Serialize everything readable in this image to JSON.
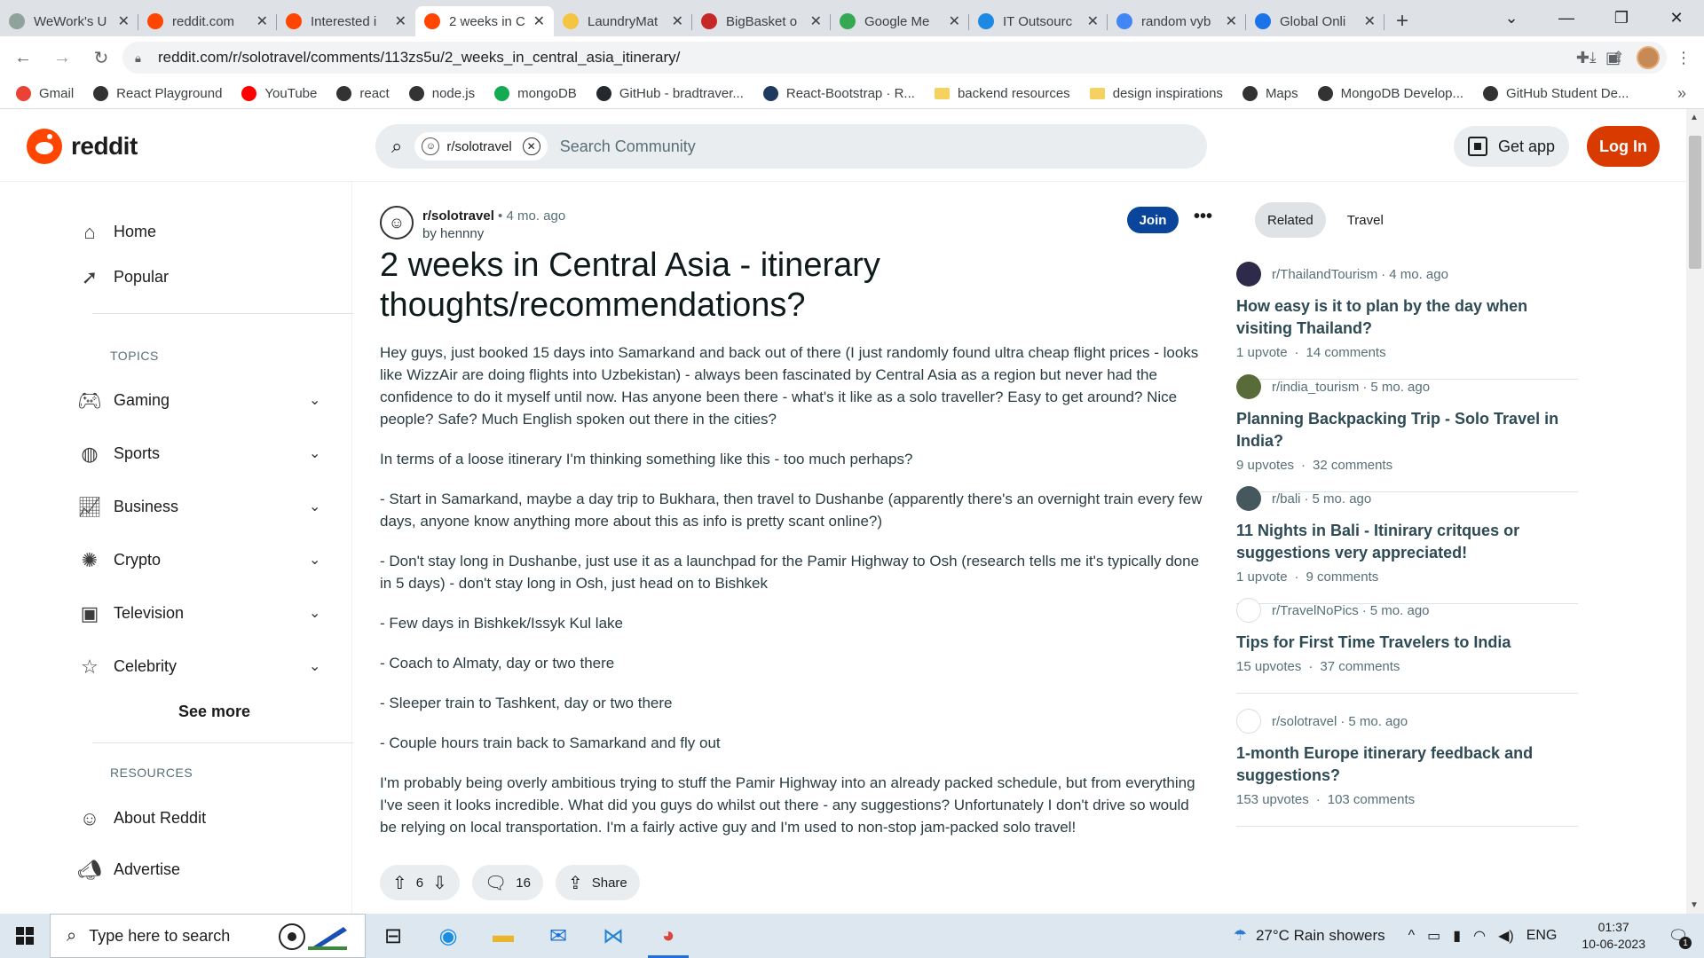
{
  "browser": {
    "tabs": [
      {
        "title": "WeWork's U",
        "icon_color": "#8fa39c",
        "active": false
      },
      {
        "title": "reddit.com",
        "icon_color": "#ff4500",
        "active": false
      },
      {
        "title": "Interested i",
        "icon_color": "#ff4500",
        "active": false
      },
      {
        "title": "2 weeks in C",
        "icon_color": "#ff4500",
        "active": true
      },
      {
        "title": "LaundryMat",
        "icon_color": "#f4c542",
        "active": false
      },
      {
        "title": "BigBasket o",
        "icon_color": "#c62828",
        "active": false
      },
      {
        "title": "Google Me",
        "icon_color": "#34a853",
        "active": false
      },
      {
        "title": "IT Outsourc",
        "icon_color": "#1e88e5",
        "active": false
      },
      {
        "title": "random vyb",
        "icon_color": "#4285f4",
        "active": false
      },
      {
        "title": "Global Onli",
        "icon_color": "#1a73e8",
        "active": false
      }
    ],
    "tab_close": "✕",
    "new_tab": "+",
    "url": "reddit.com/r/solotravel/comments/113zs5u/2_weeks_in_central_asia_itinerary/",
    "bookmarks": [
      {
        "label": "Gmail",
        "color": "#ea4335",
        "type": "icon"
      },
      {
        "label": "React Playground",
        "color": "#333333",
        "type": "icon"
      },
      {
        "label": "YouTube",
        "color": "#ff0000",
        "type": "icon"
      },
      {
        "label": "react",
        "color": "#333333",
        "type": "icon"
      },
      {
        "label": "node.js",
        "color": "#333333",
        "type": "icon"
      },
      {
        "label": "mongoDB",
        "color": "#13aa52",
        "type": "icon"
      },
      {
        "label": "GitHub - bradtraver...",
        "color": "#24292e",
        "type": "icon"
      },
      {
        "label": "React-Bootstrap · R...",
        "color": "#1f3a5f",
        "type": "icon"
      },
      {
        "label": "backend resources",
        "color": "#f5d160",
        "type": "folder"
      },
      {
        "label": "design inspirations",
        "color": "#f5d160",
        "type": "folder"
      },
      {
        "label": "Maps",
        "color": "#333333",
        "type": "icon"
      },
      {
        "label": "MongoDB Develop...",
        "color": "#333333",
        "type": "icon"
      },
      {
        "label": "GitHub Student De...",
        "color": "#333333",
        "type": "icon"
      }
    ],
    "bookmarks_more": "»"
  },
  "header": {
    "logo_text": "reddit",
    "search_chip": "r/solotravel",
    "search_placeholder": "Search Community",
    "get_app": "Get app",
    "login": "Log In"
  },
  "leftnav": {
    "home": "Home",
    "popular": "Popular",
    "topics_title": "TOPICS",
    "topics": [
      "Gaming",
      "Sports",
      "Business",
      "Crypto",
      "Television",
      "Celebrity"
    ],
    "see_more": "See more",
    "resources_title": "RESOURCES",
    "resources": [
      "About Reddit",
      "Advertise"
    ]
  },
  "post": {
    "subreddit": "r/solotravel",
    "separator": "•",
    "time": "4 mo. ago",
    "author": "by hennny",
    "join": "Join",
    "more": "•••",
    "title": "2 weeks in Central Asia - itinerary thoughts/recommendations?",
    "paragraphs": [
      "Hey guys, just booked 15 days into Samarkand and back out of there (I just randomly found ultra cheap flight prices - looks like WizzAir are doing flights into Uzbekistan) - always been fascinated by Central Asia as a region but never had the confidence to do it myself until now. Has anyone been there - what's it like as a solo traveller? Easy to get around? Nice people? Safe? Much English spoken out there in the cities?",
      "In terms of a loose itinerary I'm thinking something like this - too much perhaps?",
      "- Start in Samarkand, maybe a day trip to Bukhara, then travel to Dushanbe (apparently there's an overnight train every few days, anyone know anything more about this as info is pretty scant online?)",
      "- Don't stay long in Dushanbe, just use it as a launchpad for the Pamir Highway to Osh (research tells me it's typically done in 5 days) - don't stay long in Osh, just head on to Bishkek",
      "- Few days in Bishkek/Issyk Kul lake",
      "- Coach to Almaty, day or two there",
      "- Sleeper train to Tashkent, day or two there",
      "- Couple hours train back to Samarkand and fly out",
      "I'm probably being overly ambitious trying to stuff the Pamir Highway into an already packed schedule, but from everything I've seen it looks incredible. What did you guys do whilst out there - any suggestions? Unfortunately I don't drive so would be relying on local transportation. I'm a fairly active guy and I'm used to non-stop jam-packed solo travel!"
    ],
    "votes": "6",
    "comments": "16",
    "share": "Share"
  },
  "related": {
    "tabs": [
      "Related",
      "Travel"
    ],
    "items": [
      {
        "sub": "r/ThailandTourism",
        "time": "4 mo. ago",
        "title": "How easy is it to plan by the day when visiting Thailand?",
        "upvotes": "1 upvote",
        "comments": "14 comments",
        "icon_color": "#2d2a4a"
      },
      {
        "sub": "r/india_tourism",
        "time": "5 mo. ago",
        "title": "Planning Backpacking Trip - Solo Travel in India?",
        "upvotes": "9 upvotes",
        "comments": "32 comments",
        "icon_color": "#5a6b3a"
      },
      {
        "sub": "r/bali",
        "time": "5 mo. ago",
        "title": "11 Nights in Bali - Itinirary critques or suggestions very appreciated!",
        "upvotes": "1 upvote",
        "comments": "9 comments",
        "icon_color": "#46585e"
      },
      {
        "sub": "r/TravelNoPics",
        "time": "5 mo. ago",
        "title": "Tips for First Time Travelers to India",
        "upvotes": "15 upvotes",
        "comments": "37 comments",
        "icon_color": "#ffffff"
      },
      {
        "sub": "r/solotravel",
        "time": "5 mo. ago",
        "title": "1-month Europe itinerary feedback and suggestions?",
        "upvotes": "153 upvotes",
        "comments": "103 comments",
        "icon_color": "#ffffff"
      }
    ],
    "dot": "·"
  },
  "taskbar": {
    "search_placeholder": "Type here to search",
    "weather": "27°C  Rain showers",
    "lang": "ENG",
    "time": "01:37",
    "date": "10-06-2023",
    "notifications": "1"
  }
}
